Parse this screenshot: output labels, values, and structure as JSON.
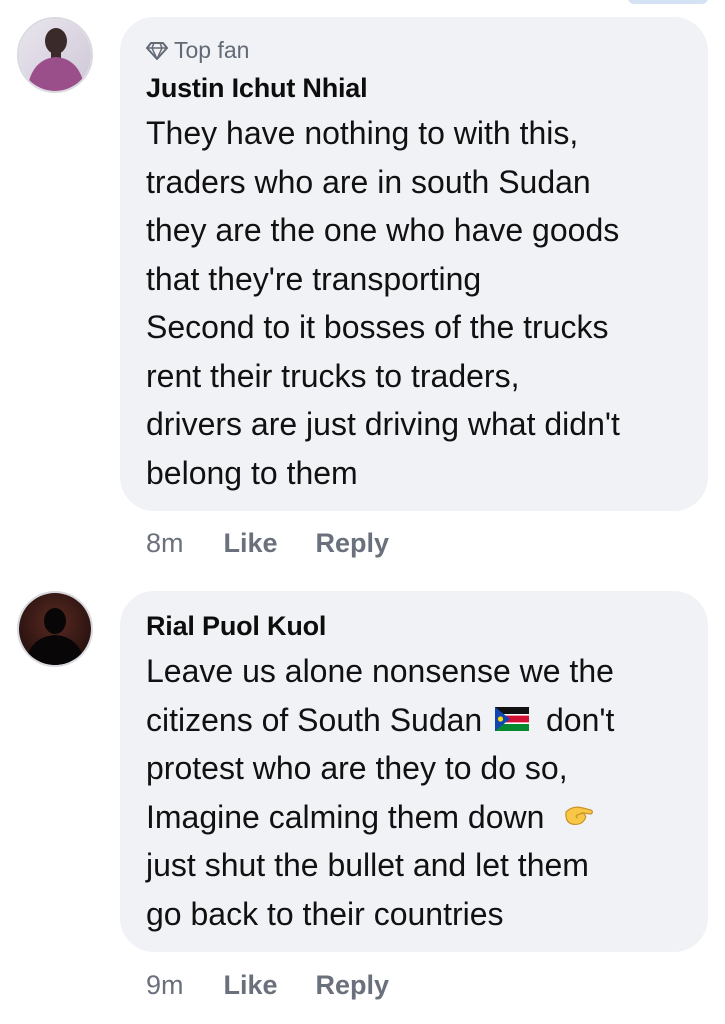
{
  "comments": [
    {
      "badge": "Top fan",
      "badge_icon": "diamond-icon",
      "author": "Justin Ichut Nhial",
      "lines": [
        "They have nothing to with this,",
        "traders who are in south Sudan",
        "they are the one who have goods",
        "that they're transporting",
        "Second to it bosses of the trucks",
        "rent their trucks to traders,",
        "drivers are just driving what didn't",
        "belong to them"
      ],
      "time": "8m",
      "like_label": "Like",
      "reply_label": "Reply"
    },
    {
      "author": "Rial Puol Kuol",
      "lines": [
        "Leave us alone nonsense we the",
        {
          "before": "citizens of South Sudan",
          "icon": "south-sudan-flag-icon",
          "after": "don't"
        },
        "protest who are they to do so,",
        {
          "before": "Imagine calming them down",
          "icon": "pinching-hand-emoji-icon",
          "after": ""
        },
        "just shut the bullet and let them",
        "go back to their countries"
      ],
      "time": "9m",
      "like_label": "Like",
      "reply_label": "Reply"
    }
  ],
  "colors": {
    "bubble": "#f1f2f6",
    "meta_text": "#6a717c",
    "badge_text": "#626a76",
    "body_text": "#111111"
  }
}
